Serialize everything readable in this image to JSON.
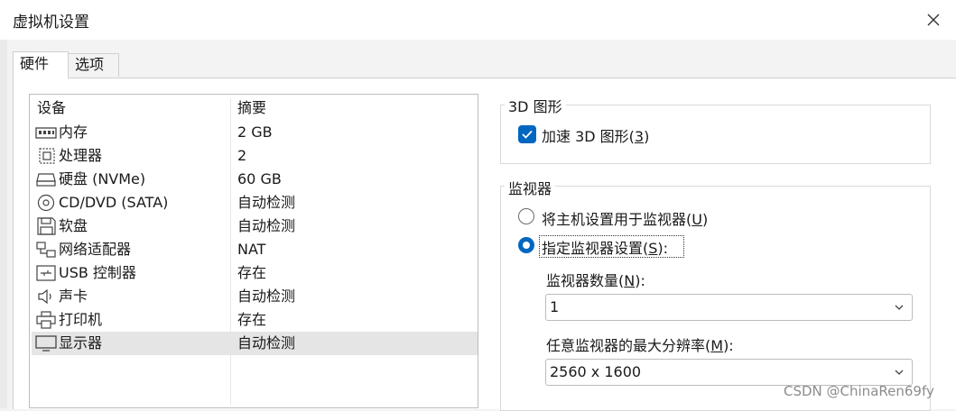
{
  "window": {
    "title": "虚拟机设置"
  },
  "tabs": [
    {
      "label": "硬件"
    },
    {
      "label": "选项"
    }
  ],
  "device_list": {
    "headers": {
      "device": "设备",
      "summary": "摘要"
    },
    "rows": [
      {
        "icon": "memory-icon",
        "name": "内存",
        "summary": "2 GB"
      },
      {
        "icon": "processor-icon",
        "name": "处理器",
        "summary": "2"
      },
      {
        "icon": "hard-disk-icon",
        "name": "硬盘 (NVMe)",
        "summary": "60 GB"
      },
      {
        "icon": "cd-dvd-icon",
        "name": "CD/DVD (SATA)",
        "summary": "自动检测"
      },
      {
        "icon": "floppy-icon",
        "name": "软盘",
        "summary": "自动检测"
      },
      {
        "icon": "network-adapter-icon",
        "name": "网络适配器",
        "summary": "NAT"
      },
      {
        "icon": "usb-icon",
        "name": "USB 控制器",
        "summary": "存在"
      },
      {
        "icon": "sound-card-icon",
        "name": "声卡",
        "summary": "自动检测"
      },
      {
        "icon": "printer-icon",
        "name": "打印机",
        "summary": "存在"
      },
      {
        "icon": "display-icon",
        "name": "显示器",
        "summary": "自动检测"
      }
    ],
    "selected_index": 9
  },
  "graphics_3d": {
    "group_title": "3D 图形",
    "accelerate_label": "加速 3D 图形(",
    "accelerate_key": "3",
    "accelerate_close": ")",
    "accelerate_checked": true
  },
  "monitor": {
    "group_title": "监视器",
    "use_host_label": "将主机设置用于监视器(",
    "use_host_key": "U",
    "use_host_close": ")",
    "specify_label": "指定监视器设置(",
    "specify_key": "S",
    "specify_close": "):",
    "selected_option": "specify",
    "count_label": "监视器数量(",
    "count_key": "N",
    "count_close": "):",
    "count_value": "1",
    "max_res_label": "任意监视器的最大分辨率(",
    "max_res_key": "M",
    "max_res_close": "):",
    "max_res_value": "2560 x 1600"
  },
  "watermark": "CSDN @ChinaRen69fy",
  "colors": {
    "accent": "#0067c0",
    "selection": "#e5e5e5"
  }
}
